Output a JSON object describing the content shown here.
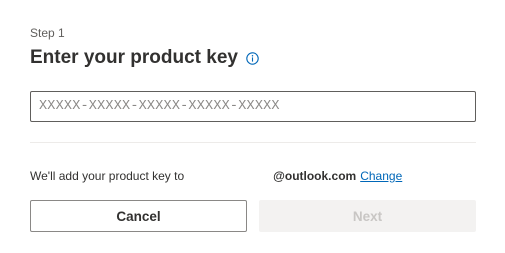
{
  "step": {
    "label": "Step 1"
  },
  "header": {
    "title": "Enter your product key",
    "info_icon": "info-icon"
  },
  "product_key": {
    "value": "",
    "placeholder": "XXXXX-XXXXX-XXXXX-XXXXX-XXXXX"
  },
  "account": {
    "prefix_text": "We'll add your product key to",
    "email": "@outlook.com",
    "change_label": "Change"
  },
  "actions": {
    "cancel_label": "Cancel",
    "next_label": "Next",
    "next_enabled": false
  },
  "colors": {
    "link": "#0067b8",
    "text": "#323130",
    "disabled_bg": "#f3f2f1",
    "disabled_text": "#c8c6c4"
  }
}
